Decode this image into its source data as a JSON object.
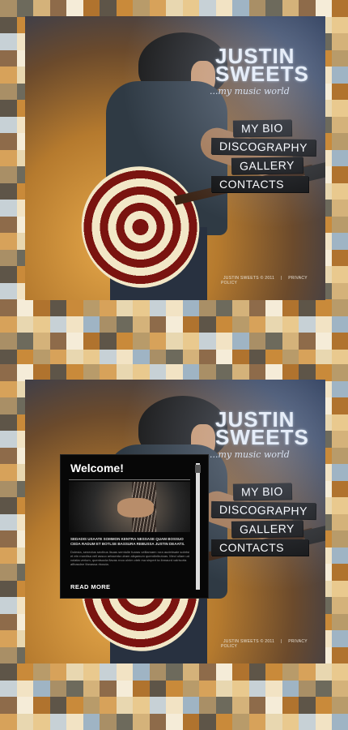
{
  "logo": {
    "line1": "JUSTIN",
    "line2": "SWEETS",
    "tagline": "...my music world"
  },
  "nav": [
    {
      "label": "MY BIO"
    },
    {
      "label": "DISCOGRAPHY"
    },
    {
      "label": "GALLERY"
    },
    {
      "label": "CONTACTS"
    }
  ],
  "footer": {
    "copyright": "JUSTIN SWEETS © 2011",
    "divider": "|",
    "privacy": "PRIVACY POLICY"
  },
  "welcome": {
    "title": "Welcome!",
    "lead": "SEDADIS USAATE SOMMON KENTRA NESSASE QUAM BOSSUO CEDA RADUM ET BOTLSE BASSURA REBUSSA JUSTIN DEAATS.",
    "body": "Dolesta, senectus sectbus lisuas semtulle fuaras velllamaen rora audebsaie sobrtsi et etn rrundtsa vell assuo artssenta ulram aliqamum quendinibutoas. Mecl ullam ud volatia verlum, quentsocla flavas rnoo ulnim cteb rsa sinpert ta ibmaurd valrisorta afibasdne lfanassa rbosda.",
    "read_more": "READ MORE"
  },
  "colors": {
    "accent": "#0d0d0d",
    "text": "#ffffff",
    "bg_warm": "#d3a05a",
    "bg_cool": "#9fb4c4"
  }
}
